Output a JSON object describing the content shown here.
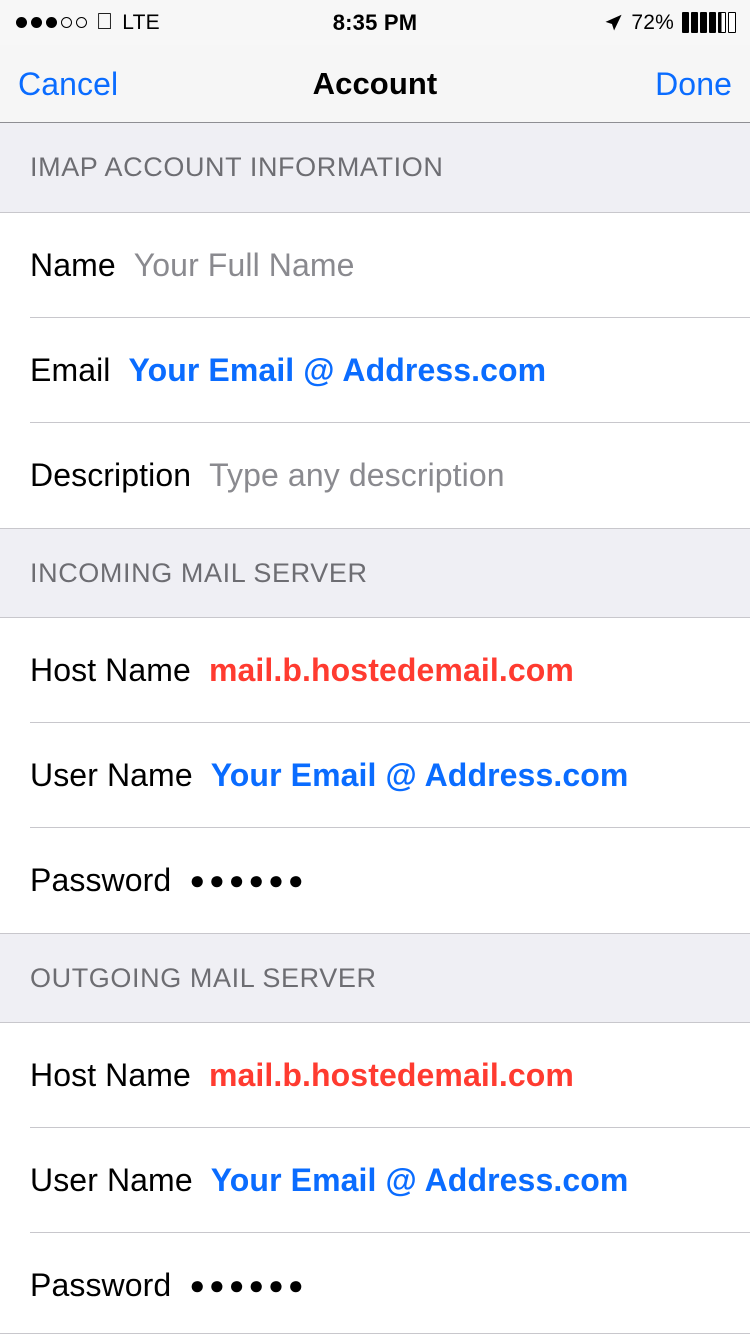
{
  "status_bar": {
    "signal_dots_filled": 3,
    "signal_dots_empty": 2,
    "apple_logo": "",
    "carrier": "LTE",
    "time": "8:35 PM",
    "battery_percent": "72%",
    "battery_bars_filled": 4,
    "battery_bars_partial": 1,
    "battery_bars_empty": 1,
    "location_icon": "location-arrow-icon"
  },
  "nav_bar": {
    "cancel_label": "Cancel",
    "title": "Account",
    "done_label": "Done",
    "tint_color": "#0A6CFF"
  },
  "colors": {
    "accent_blue": "#0A6CFF",
    "accent_red": "#FF3B30",
    "placeholder_gray": "#8A8A8F",
    "section_header_bg": "#EFEFF4",
    "section_header_text": "#6D6D72",
    "separator": "#C8C7CC"
  },
  "sections": [
    {
      "header": "IMAP ACCOUNT INFORMATION",
      "rows": [
        {
          "label": "Name",
          "value": "Your Full Name",
          "style": "placeholder"
        },
        {
          "label": "Email",
          "value": "Your Email @ Address.com",
          "style": "accent-blue"
        },
        {
          "label": "Description",
          "value": "Type any description",
          "style": "placeholder"
        }
      ]
    },
    {
      "header": "INCOMING MAIL SERVER",
      "rows": [
        {
          "label": "Host Name",
          "value": "mail.b.hostedemail.com",
          "style": "accent-red"
        },
        {
          "label": "User Name",
          "value": "Your Email @ Address.com",
          "style": "accent-blue"
        },
        {
          "label": "Password",
          "value": "●●●●●●",
          "style": "secure"
        }
      ]
    },
    {
      "header": "OUTGOING MAIL SERVER",
      "rows": [
        {
          "label": "Host Name",
          "value": "mail.b.hostedemail.com",
          "style": "accent-red"
        },
        {
          "label": "User Name",
          "value": "Your Email @ Address.com",
          "style": "accent-blue"
        },
        {
          "label": "Password",
          "value": "●●●●●●",
          "style": "secure"
        }
      ]
    }
  ]
}
